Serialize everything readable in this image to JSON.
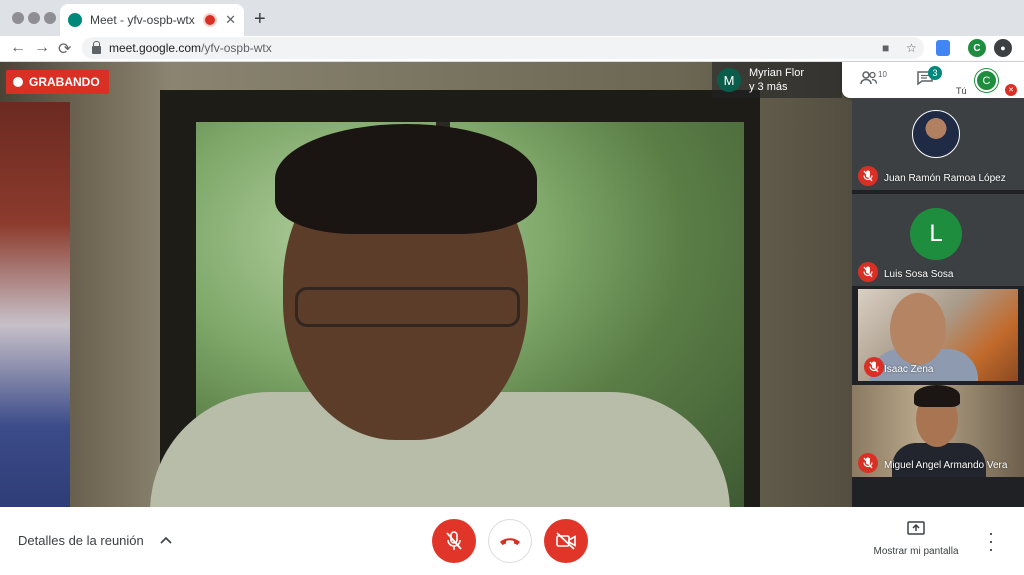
{
  "browser": {
    "tab_title": "Meet - yfv-ospb-wtx",
    "tab_close": "✕",
    "new_tab": "+",
    "url_host": "meet.google.com",
    "url_path": "/yfv-ospb-wtx",
    "nav_back": "←",
    "nav_forward": "→",
    "nav_reload": "⟳",
    "profile_initial": "C"
  },
  "meeting": {
    "recording_label": "GRABANDO",
    "presenter_initial": "M",
    "presenter_line1": "Myrian Flor",
    "presenter_line2": "y 3 más",
    "participants_count": "10",
    "chat_count": "3",
    "self_initial": "C",
    "self_label": "Tú"
  },
  "participants": [
    {
      "name": "Juan Ramón Ramoa López"
    },
    {
      "name": "Luis Sosa Sosa",
      "initial": "L"
    },
    {
      "name": "Isaac Zena"
    },
    {
      "name": "Miguel Angel Armando Vera"
    }
  ],
  "bottom": {
    "details_label": "Detalles de la reunión",
    "present_label": "Mostrar mi pantalla"
  },
  "colors": {
    "accent_red": "#d93025",
    "meet_green": "#00897b",
    "avatar_green": "#1e8e3e"
  }
}
